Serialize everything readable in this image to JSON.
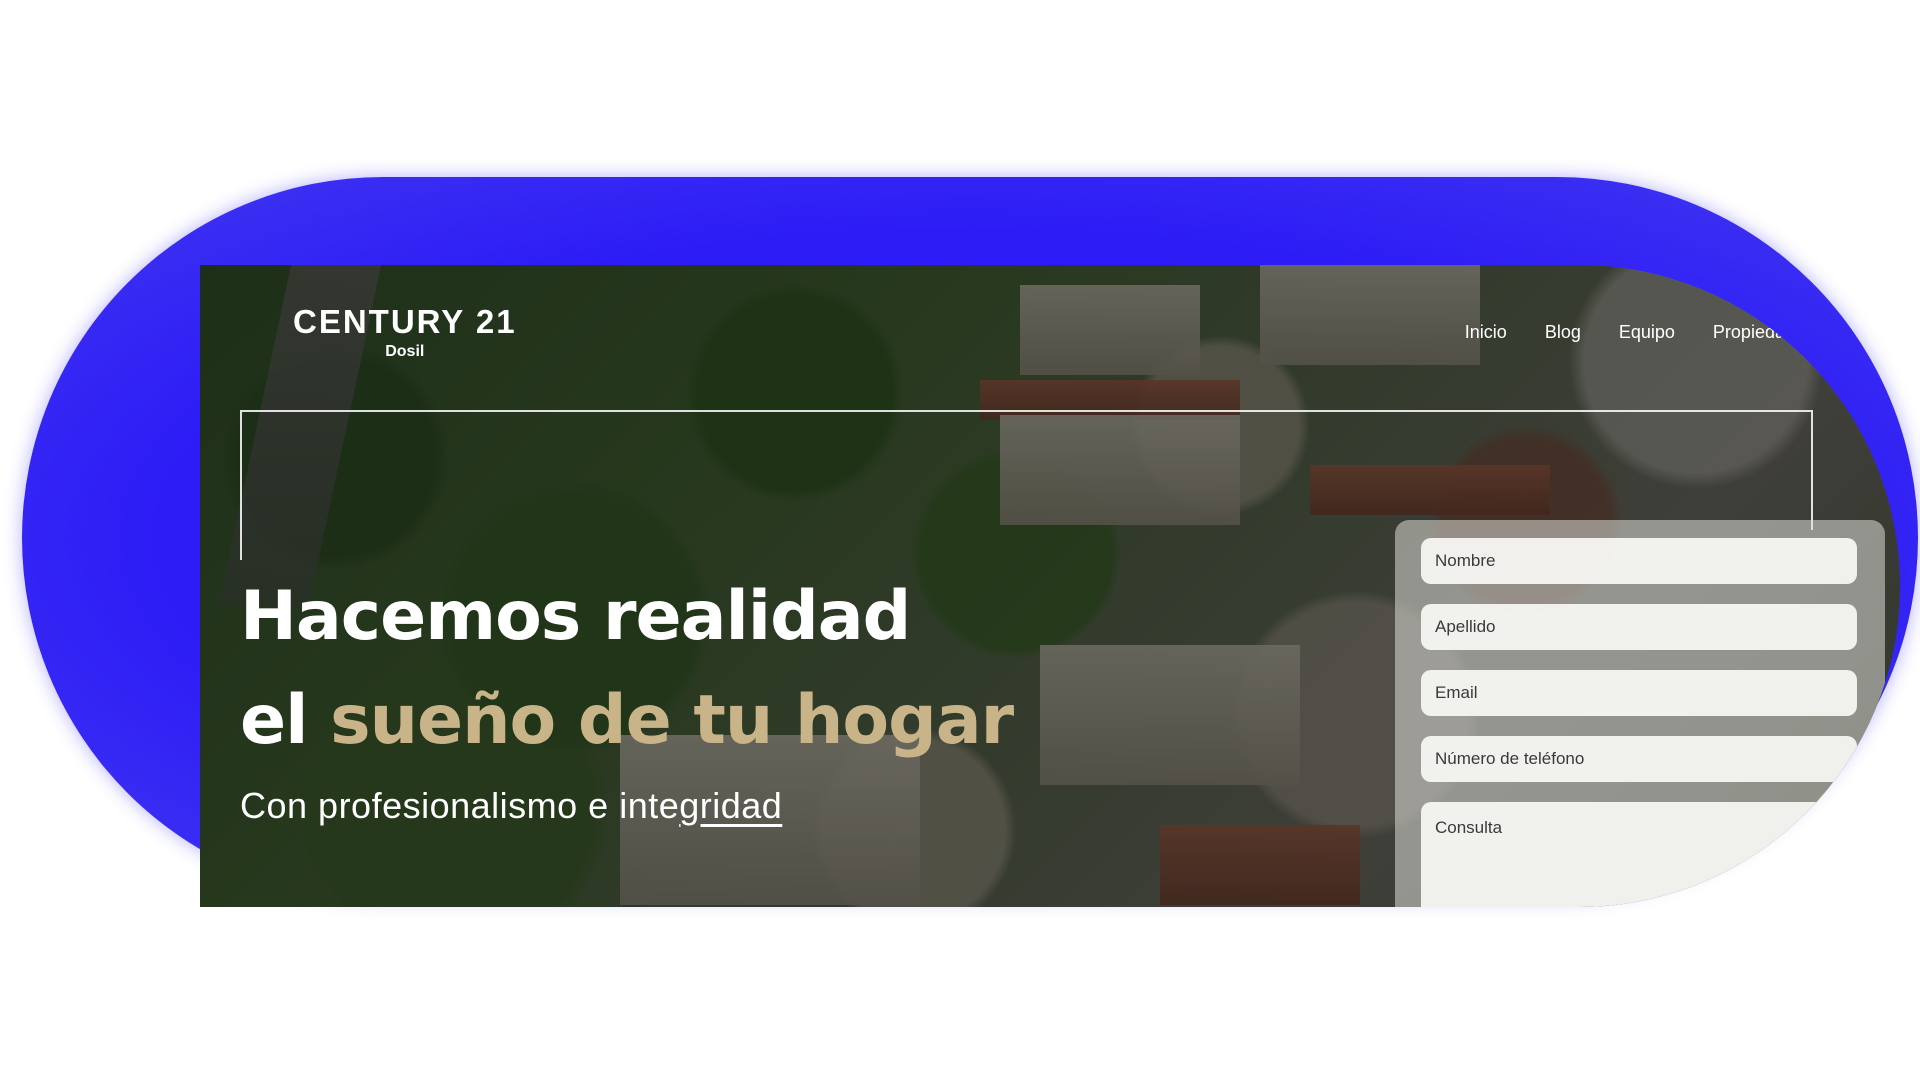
{
  "logo": {
    "brand": "CENTURY 21",
    "office": "Dosil"
  },
  "nav": {
    "items": [
      {
        "label": "Inicio"
      },
      {
        "label": "Blog"
      },
      {
        "label": "Equipo"
      },
      {
        "label": "Propiedades"
      }
    ]
  },
  "hero": {
    "line1": "Hacemos realidad",
    "line2_prefix": "el ",
    "line2_accent": "sueño de tu hogar",
    "sub_prefix": "Con profesionalismo e inte",
    "sub_underlined": "gridad"
  },
  "form": {
    "nombre_placeholder": "Nombre",
    "apellido_placeholder": "Apellido",
    "email_placeholder": "Email",
    "telefono_placeholder": "Número de teléfono",
    "consulta_placeholder": "Consulta"
  },
  "colors": {
    "pill_blue": "#2a16ff",
    "accent_gold": "#c9b48a",
    "text_white": "#ffffff"
  }
}
